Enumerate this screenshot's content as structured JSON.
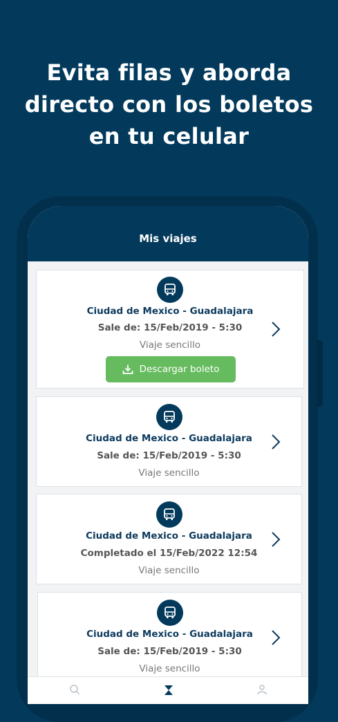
{
  "promo": {
    "headline_line1": "Evita filas y aborda",
    "headline_line2": "directo con los boletos",
    "headline_line3": "en tu celular"
  },
  "app_bar": {
    "title": "Mis viajes"
  },
  "trips": [
    {
      "route": "Ciudad de Mexico - Guadalajara",
      "departure": "Sale de: 15/Feb/2019 - 5:30",
      "trip_type": "Viaje sencillo",
      "download_label": "Descargar boleto"
    },
    {
      "route": "Ciudad de Mexico - Guadalajara",
      "departure": "Sale de: 15/Feb/2019 - 5:30",
      "trip_type": "Viaje sencillo"
    },
    {
      "route": "Ciudad de Mexico - Guadalajara",
      "departure": "Completado el 15/Feb/2022  12:54",
      "trip_type": "Viaje sencillo"
    },
    {
      "route": "Ciudad de Mexico - Guadalajara",
      "departure": "Sale de: 15/Feb/2019 - 5:30",
      "trip_type": "Viaje sencillo"
    }
  ],
  "icons": {
    "trip": "bus-icon",
    "detail": "chevron-right-icon",
    "download": "download-icon",
    "nav": [
      "search-icon",
      "tickets-icon",
      "profile-icon"
    ]
  },
  "colors": {
    "brand_navy": "#033a5c",
    "download_green": "#66bb5e",
    "card_background": "#ffffff",
    "screen_background": "#f2f3f5"
  }
}
